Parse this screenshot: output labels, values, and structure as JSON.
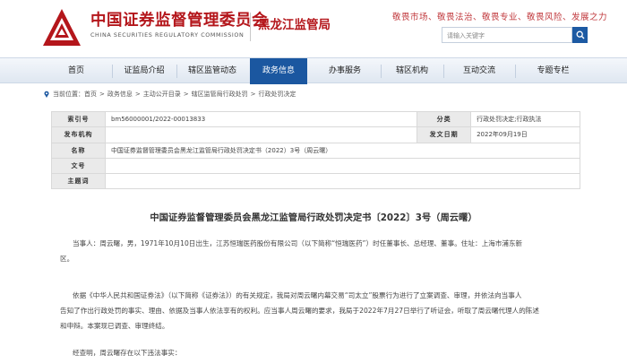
{
  "header": {
    "org_name_cn": "中国证券监督管理委员会",
    "org_name_en": "CHINA SECURITIES REGULATORY COMMISSION",
    "region": "黑龙江监管局",
    "slogan": "敬畏市场、敬畏法治、敬畏专业、敬畏风险、发展之力",
    "search": {
      "placeholder": "请输入关键字"
    }
  },
  "nav": {
    "items": [
      {
        "label": "首页"
      },
      {
        "label": "证监局介绍"
      },
      {
        "label": "辖区监管动态"
      },
      {
        "label": "政务信息"
      },
      {
        "label": "办事服务"
      },
      {
        "label": "辖区机构"
      },
      {
        "label": "互动交流"
      },
      {
        "label": "专题专栏"
      }
    ],
    "active_index": 3
  },
  "breadcrumb": {
    "prefix": "当前位置：",
    "items": [
      "首页",
      "政务信息",
      "主动公开目录",
      "辖区监管局行政处罚",
      "行政处罚决定"
    ]
  },
  "info": {
    "index_label": "索引号",
    "index_value": "bm56000001/2022-00013833",
    "category_label": "分类",
    "category_value": "行政处罚决定;行政执法",
    "publisher_label": "发布机构",
    "publisher_value": "",
    "date_label": "发文日期",
    "date_value": "2022年09月19日",
    "name_label": "名称",
    "name_value": "中国证券监督管理委员会黑龙江监管局行政处罚决定书（2022）3号（周云曙）",
    "docno_label": "文号",
    "docno_value": "",
    "theme_label": "主题词",
    "theme_value": ""
  },
  "document": {
    "title": "中国证券监督管理委员会黑龙江监管局行政处罚决定书〔2022〕3号（周云曙）",
    "paragraphs": [
      "当事人：周云曙，男，1971年10月10日出生，江苏恒瑞医药股份有限公司（以下简称“恒瑞医药”）时任董事长、总经理、董事。住址：上海市浦东新",
      "区。",
      "依据《中华人民共和国证券法》（以下简称《证券法》）的有关规定，我局对周云曙内幕交易“司太立”股票行为进行了立案调查、审理，并依法向当事人",
      "告知了作出行政处罚的事实、理由、依据及当事人依法享有的权利。应当事人周云曙的要求，我局于2022年7月27日举行了听证会，听取了周云曙代理人的陈述",
      "和申辩。本案现已调查、审理终结。",
      "经查明，周云曙存在以下违法事实："
    ]
  },
  "colors": {
    "brand_red": "#b4161b",
    "nav_active": "#1b57a0",
    "label_bg": "#eaeaea"
  }
}
